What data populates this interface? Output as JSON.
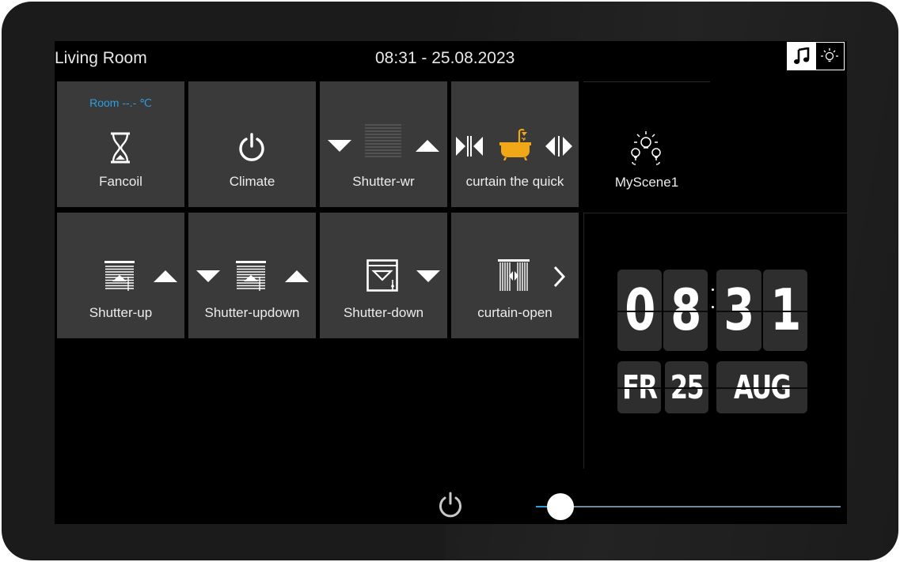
{
  "header": {
    "room_title": "Living Room",
    "datetime": "08:31 - 25.08.2023"
  },
  "mode_toggle": {
    "left_icon": "music-note-icon",
    "right_icon": "light-bulb-icon",
    "selected": "music"
  },
  "tiles": [
    {
      "label": "Fancoil",
      "sublabel": "Room --.- ℃",
      "icon": "hourglass-icon"
    },
    {
      "label": "Climate",
      "icon": "power-icon"
    },
    {
      "label": "Shutter-wr",
      "icons": [
        "arrow-down-icon",
        "blind-icon",
        "arrow-up-icon"
      ]
    },
    {
      "label": "curtain the quick",
      "icons": [
        "curtain-close-icon",
        "bathtub-icon",
        "curtain-open-icon"
      ]
    },
    {
      "label": "MyScene1",
      "icon": "scene-bulbs-icon"
    },
    {
      "label": "Shutter-up",
      "icons": [
        "shutter-icon",
        "arrow-up-icon"
      ]
    },
    {
      "label": "Shutter-updown",
      "icons": [
        "arrow-down-icon",
        "shutter-icon",
        "arrow-up-icon"
      ]
    },
    {
      "label": "Shutter-down",
      "icons": [
        "shutter-down-icon",
        "arrow-down-icon"
      ]
    },
    {
      "label": "curtain-open",
      "icons": [
        "curtain-icon",
        "chevron-right-icon"
      ]
    }
  ],
  "clock": {
    "hour_tens": "0",
    "hour_ones": "8",
    "minute_tens": "3",
    "minute_ones": "1",
    "weekday": "FR",
    "day": "25",
    "month": "AUG"
  },
  "bottom": {
    "power_icon": "power-icon",
    "slider_value": 0.08
  },
  "colors": {
    "accent": "#2c9fe3",
    "bath_icon": "#f0a818",
    "tile_bg": "#3a3a3a"
  }
}
